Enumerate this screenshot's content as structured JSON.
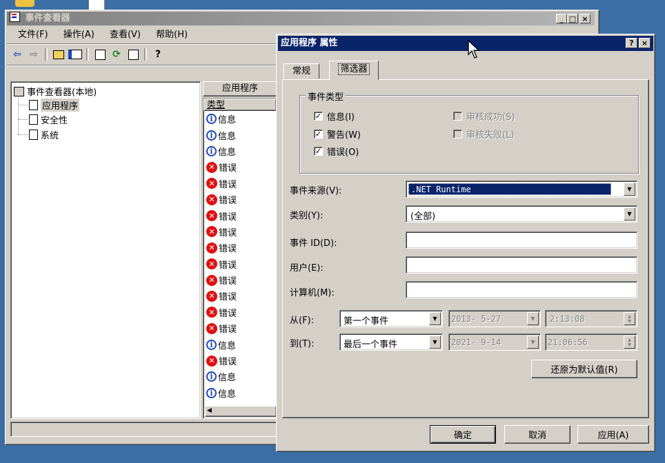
{
  "main_window": {
    "title": "事件查看器",
    "menu": [
      "文件(F)",
      "操作(A)",
      "查看(V)",
      "帮助(H)"
    ],
    "tree": {
      "root": "事件查看器(本地)",
      "items": [
        "应用程序",
        "安全性",
        "系统"
      ]
    },
    "list_title": "应用程序",
    "column_header": "类型",
    "rows": [
      {
        "type": "info",
        "label": "信息"
      },
      {
        "type": "info",
        "label": "信息"
      },
      {
        "type": "info",
        "label": "信息"
      },
      {
        "type": "error",
        "label": "错误"
      },
      {
        "type": "error",
        "label": "错误"
      },
      {
        "type": "error",
        "label": "错误"
      },
      {
        "type": "error",
        "label": "错误"
      },
      {
        "type": "error",
        "label": "错误"
      },
      {
        "type": "error",
        "label": "错误"
      },
      {
        "type": "error",
        "label": "错误"
      },
      {
        "type": "error",
        "label": "错误"
      },
      {
        "type": "error",
        "label": "错误"
      },
      {
        "type": "error",
        "label": "错误"
      },
      {
        "type": "error",
        "label": "错误"
      },
      {
        "type": "info",
        "label": "信息"
      },
      {
        "type": "error",
        "label": "错误"
      },
      {
        "type": "info",
        "label": "信息"
      },
      {
        "type": "info",
        "label": "信息"
      }
    ]
  },
  "dialog": {
    "title": "应用程序 属性",
    "help_btn": "?",
    "close_btn": "×",
    "tabs": [
      "常规",
      "筛选器"
    ],
    "active_tab": "筛选器",
    "group_title": "事件类型",
    "checkboxes": [
      {
        "label": "信息(I)",
        "checked": true,
        "enabled": true
      },
      {
        "label": "警告(W)",
        "checked": true,
        "enabled": true
      },
      {
        "label": "错误(O)",
        "checked": true,
        "enabled": true
      },
      {
        "label": "审核成功(S)",
        "checked": false,
        "enabled": false
      },
      {
        "label": "审核失败(L)",
        "checked": false,
        "enabled": false
      }
    ],
    "event_source_label": "事件来源(V):",
    "event_source_value": ".NET Runtime",
    "category_label": "类别(Y):",
    "category_value": "(全部)",
    "event_id_label": "事件 ID(D):",
    "event_id_value": "",
    "user_label": "用户(E):",
    "user_value": "",
    "computer_label": "计算机(M):",
    "computer_value": "",
    "from_label": "从(F):",
    "from_select": "第一个事件",
    "from_date": "2013- 5-27",
    "from_time": "2:13:08",
    "to_label": "到(T):",
    "to_select": "最后一个事件",
    "to_date": "2021- 9-14",
    "to_time": "21:06:56",
    "restore_defaults": "还原为默认值(R)",
    "ok": "确定",
    "cancel": "取消",
    "apply": "应用(A)"
  },
  "colors": {
    "desktop": "#3a6ea5",
    "active_title": "#0a246a",
    "inactive_title": "#808080",
    "face": "#d4d0c8",
    "selected": "#0a246a"
  }
}
